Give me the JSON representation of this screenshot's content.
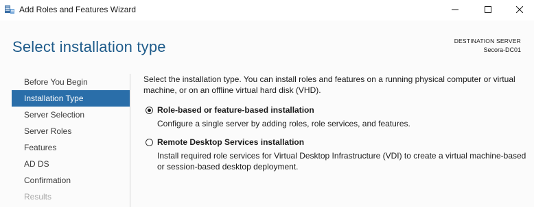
{
  "window": {
    "title": "Add Roles and Features Wizard",
    "icon": "server-manager-icon",
    "controls": [
      "minimize-icon",
      "maximize-icon",
      "close-icon"
    ]
  },
  "page": {
    "title": "Select installation type",
    "destination_label": "DESTINATION SERVER",
    "destination_server": "Secora-DC01"
  },
  "nav": {
    "items": [
      {
        "label": "Before You Begin",
        "state": "normal"
      },
      {
        "label": "Installation Type",
        "state": "active"
      },
      {
        "label": "Server Selection",
        "state": "normal"
      },
      {
        "label": "Server Roles",
        "state": "normal"
      },
      {
        "label": "Features",
        "state": "normal"
      },
      {
        "label": "AD DS",
        "state": "normal"
      },
      {
        "label": "Confirmation",
        "state": "normal"
      },
      {
        "label": "Results",
        "state": "disabled"
      }
    ]
  },
  "main": {
    "intro": "Select the installation type. You can install roles and features on a running physical computer or virtual machine, or on an offline virtual hard disk (VHD).",
    "options": [
      {
        "title": "Role-based or feature-based installation",
        "description": "Configure a single server by adding roles, role services, and features.",
        "selected": true
      },
      {
        "title": "Remote Desktop Services installation",
        "description": "Install required role services for Virtual Desktop Infrastructure (VDI) to create a virtual machine-based or session-based desktop deployment.",
        "selected": false
      }
    ]
  },
  "colors": {
    "accent": "#2a6ea9",
    "title": "#1e5b8a",
    "disabled_text": "#a8a8a8"
  }
}
